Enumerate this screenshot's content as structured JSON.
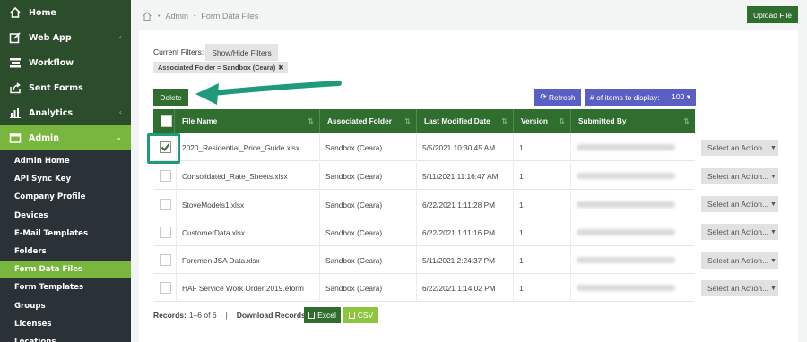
{
  "sidebar": {
    "items": [
      {
        "label": "Home",
        "icon": "home-icon",
        "chevron": ""
      },
      {
        "label": "Web App",
        "icon": "edit-icon",
        "chevron": "‹"
      },
      {
        "label": "Workflow",
        "icon": "workflow-icon",
        "chevron": ""
      },
      {
        "label": "Sent Forms",
        "icon": "share-icon",
        "chevron": ""
      },
      {
        "label": "Analytics",
        "icon": "bar-chart-icon",
        "chevron": "‹"
      },
      {
        "label": "Admin",
        "icon": "folder-icon",
        "chevron": "⌄"
      }
    ],
    "admin_sub": [
      "Admin Home",
      "API Sync Key",
      "Company Profile",
      "Devices",
      "E-Mail Templates",
      "Folders",
      "Form Data Files",
      "Form Templates",
      "Groups",
      "Licenses",
      "Locations"
    ],
    "active_sub": "Form Data Files"
  },
  "breadcrumb": {
    "items": [
      "Admin",
      "Form Data Files"
    ],
    "separator": "•"
  },
  "upload_label": "Upload File",
  "filters": {
    "label": "Current Filters:",
    "toggle_label": "Show/Hide Filters",
    "tag": "Associated Folder = Sandbox (Ceara)",
    "tag_remove": "✖"
  },
  "toolbar": {
    "delete_label": "Delete",
    "refresh_label": "Refresh",
    "items_label": "# of items to display:",
    "items_value": "100"
  },
  "table": {
    "columns": [
      "File Name",
      "Associated Folder",
      "Last Modified Date",
      "Version",
      "Submitted By"
    ],
    "rows": [
      {
        "file": "2020_Residential_Price_Guide.xlsx",
        "folder": "Sandbox (Ceara)",
        "date": "5/5/2021 10:30:45 AM",
        "version": "1",
        "checked": true
      },
      {
        "file": "Consolidated_Rate_Sheets.xlsx",
        "folder": "Sandbox (Ceara)",
        "date": "5/11/2021 11:16:47 AM",
        "version": "1",
        "checked": false
      },
      {
        "file": "StoveModels1.xlsx",
        "folder": "Sandbox (Ceara)",
        "date": "6/22/2021 1:11:28 PM",
        "version": "1",
        "checked": false
      },
      {
        "file": "CustomerData.xlsx",
        "folder": "Sandbox (Ceara)",
        "date": "6/22/2021 1:11:16 PM",
        "version": "1",
        "checked": false
      },
      {
        "file": "Foremen JSA Data.xlsx",
        "folder": "Sandbox (Ceara)",
        "date": "5/11/2021 2:24:37 PM",
        "version": "1",
        "checked": false
      },
      {
        "file": "HAF Service Work Order 2019.eform",
        "folder": "Sandbox (Ceara)",
        "date": "6/22/2021 1:14:02 PM",
        "version": "1",
        "checked": false
      }
    ],
    "action_label": "Select an Action..."
  },
  "footer": {
    "records_label": "Records:",
    "records_value": "1–6 of 6",
    "divider": "|",
    "download_label": "Download Records",
    "excel_label": "Excel",
    "csv_label": "CSV"
  },
  "colors": {
    "sidebar_bg": "#2c4d2c",
    "accent_green": "#79b63d",
    "dark_green": "#2f6e2f",
    "purple": "#5a5fc4",
    "annotation_teal": "#1f9a7d"
  }
}
